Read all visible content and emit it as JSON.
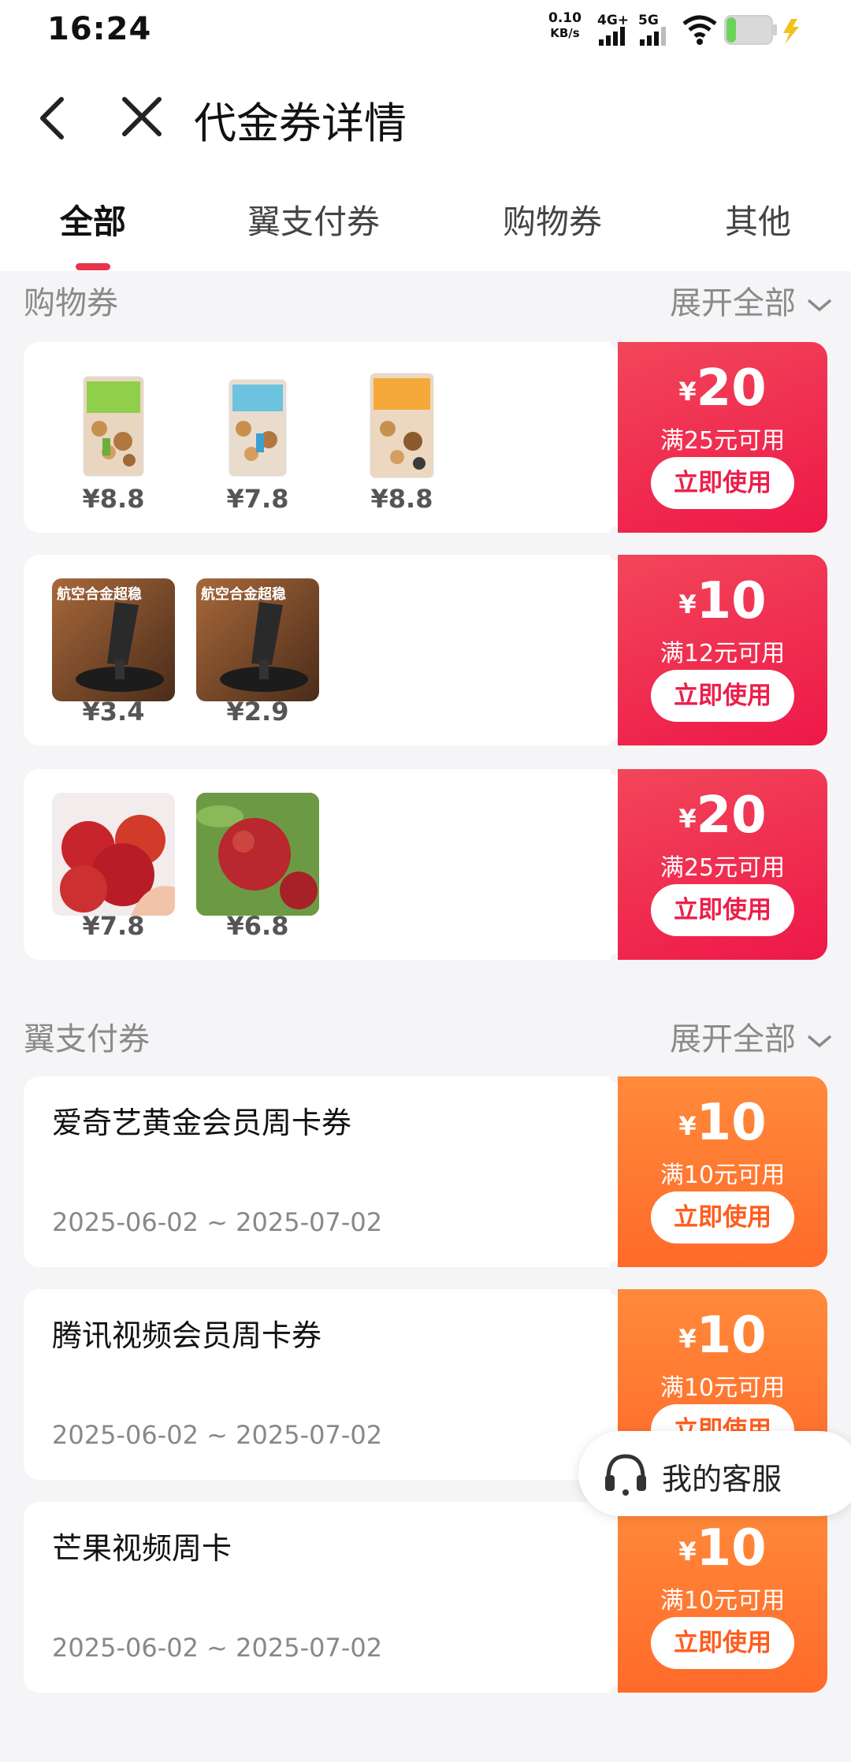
{
  "status_bar": {
    "time": "16:24",
    "net_speed_value": "0.10",
    "net_speed_unit": "KB/s",
    "signal1_label": "4G+",
    "signal2_label": "5G"
  },
  "header": {
    "title": "代金券详情"
  },
  "tabs": [
    {
      "label": "全部"
    },
    {
      "label": "翼支付券"
    },
    {
      "label": "购物券"
    },
    {
      "label": "其他"
    }
  ],
  "sections": {
    "shopping": {
      "title": "购物券",
      "expand": "展开全部"
    },
    "payment": {
      "title": "翼支付券",
      "expand": "展开全部"
    }
  },
  "shopping_coupons": [
    {
      "products": [
        {
          "price": "¥8.8"
        },
        {
          "price": "¥7.8"
        },
        {
          "price": "¥8.8"
        }
      ],
      "yen": "¥",
      "amount": "20",
      "condition": "满25元可用",
      "button": "立即使用"
    },
    {
      "products": [
        {
          "price": "¥3.4"
        },
        {
          "price": "¥2.9"
        }
      ],
      "product_badge": "航空合金超稳",
      "yen": "¥",
      "amount": "10",
      "condition": "满12元可用",
      "button": "立即使用"
    },
    {
      "products": [
        {
          "price": "¥7.8"
        },
        {
          "price": "¥6.8"
        }
      ],
      "yen": "¥",
      "amount": "20",
      "condition": "满25元可用",
      "button": "立即使用"
    }
  ],
  "payment_coupons": [
    {
      "name": "爱奇艺黄金会员周卡券",
      "dates": "2025-06-02 ~ 2025-07-02",
      "yen": "¥",
      "amount": "10",
      "condition": "满10元可用",
      "button": "立即使用"
    },
    {
      "name": "腾讯视频会员周卡券",
      "dates": "2025-06-02 ~ 2025-07-02",
      "yen": "¥",
      "amount": "10",
      "condition": "满10元可用",
      "button": "立即使用"
    },
    {
      "name": "芒果视频周卡",
      "dates": "2025-06-02 ~ 2025-07-02",
      "yen": "¥",
      "amount": "10",
      "condition": "满10元可用",
      "button": "立即使用"
    }
  ],
  "floating_service": {
    "label": "我的客服"
  },
  "colors": {
    "accent_red": "#ec1e4a",
    "accent_orange": "#ff6a2a",
    "tab_indicator": "#e8344a"
  }
}
